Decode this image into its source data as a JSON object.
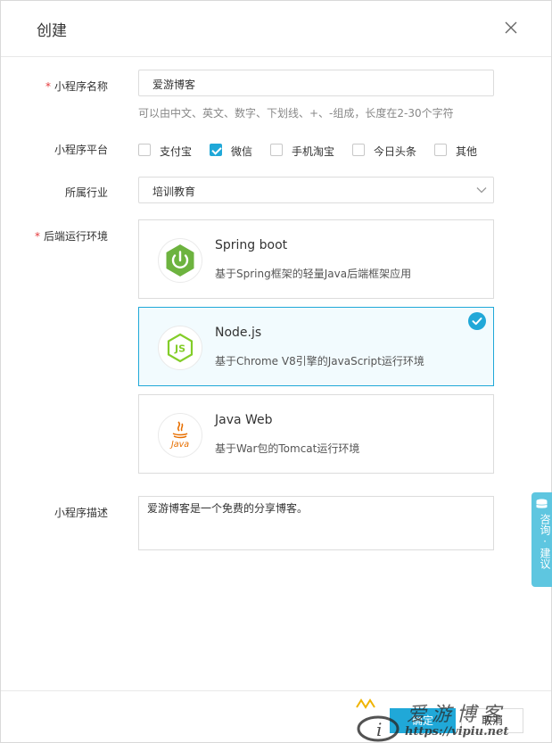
{
  "dialog": {
    "title": "创建"
  },
  "form": {
    "name": {
      "required_mark": "*",
      "label": "小程序名称",
      "value": "爱游博客",
      "hint": "可以由中文、英文、数字、下划线、+、-组成，长度在2-30个字符"
    },
    "platform": {
      "label": "小程序平台",
      "options": [
        {
          "label": "支付宝",
          "checked": false
        },
        {
          "label": "微信",
          "checked": true
        },
        {
          "label": "手机淘宝",
          "checked": false
        },
        {
          "label": "今日头条",
          "checked": false
        },
        {
          "label": "其他",
          "checked": false
        }
      ]
    },
    "industry": {
      "label": "所属行业",
      "value": "培训教育"
    },
    "runtime": {
      "required_mark": "*",
      "label": "后端运行环境",
      "options": [
        {
          "title": "Spring boot",
          "desc": "基于Spring框架的轻量Java后端框架应用",
          "icon": "spring-boot-logo",
          "selected": false
        },
        {
          "title": "Node.js",
          "desc": "基于Chrome V8引擎的JavaScript运行环境",
          "icon": "nodejs-logo",
          "selected": true
        },
        {
          "title": "Java Web",
          "desc": "基于War包的Tomcat运行环境",
          "icon": "java-logo",
          "selected": false
        }
      ]
    },
    "description": {
      "label": "小程序描述",
      "value": "爱游博客是一个免费的分享博客。"
    }
  },
  "footer": {
    "ok_label": "确定",
    "cancel_label": "取消"
  },
  "float_tab": {
    "label": "咨询·建议",
    "icon": "database-icon"
  },
  "watermark": {
    "text": "爱游博客",
    "url": "https://vipiu.net"
  },
  "colors": {
    "accent": "#20a8d8",
    "required": "#e4393c",
    "spring": "#6db33f",
    "node": "#83cd29",
    "java": "#e76f00"
  }
}
